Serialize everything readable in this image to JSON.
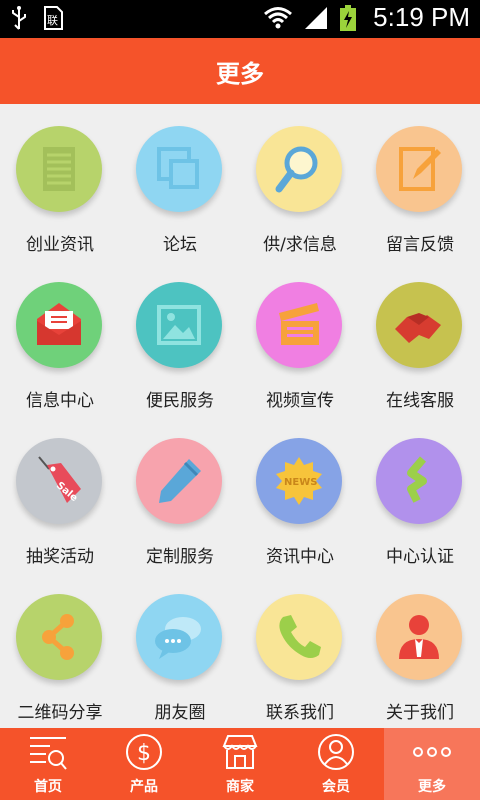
{
  "status_bar": {
    "time": "5:19 PM"
  },
  "header": {
    "title": "更多"
  },
  "grid": {
    "items": [
      {
        "label": "创业资讯",
        "icon": "document-icon",
        "color": "#b7d36b"
      },
      {
        "label": "论坛",
        "icon": "windows-icon",
        "color": "#8fd6f2"
      },
      {
        "label": "供/求信息",
        "icon": "magnifier-icon",
        "color": "#f9e596"
      },
      {
        "label": "留言反馈",
        "icon": "edit-icon",
        "color": "#f9c58f"
      },
      {
        "label": "信息中心",
        "icon": "envelope-icon",
        "color": "#6fd17a"
      },
      {
        "label": "便民服务",
        "icon": "picture-icon",
        "color": "#4dc3c1"
      },
      {
        "label": "视频宣传",
        "icon": "clapperboard-icon",
        "color": "#f07fe2"
      },
      {
        "label": "在线客服",
        "icon": "handshake-icon",
        "color": "#c6c24f"
      },
      {
        "label": "抽奖活动",
        "icon": "sale-tag-icon",
        "color": "#c3c7cd"
      },
      {
        "label": "定制服务",
        "icon": "pen-icon",
        "color": "#f7a3ad"
      },
      {
        "label": "资讯中心",
        "icon": "news-badge-icon",
        "color": "#86a3e6"
      },
      {
        "label": "中心认证",
        "icon": "certification-icon",
        "color": "#b191ec"
      },
      {
        "label": "二维码分享",
        "icon": "share-icon",
        "color": "#b7d36b"
      },
      {
        "label": "朋友圈",
        "icon": "chat-bubbles-icon",
        "color": "#8fd6f2"
      },
      {
        "label": "联系我们",
        "icon": "phone-icon",
        "color": "#f9e596"
      },
      {
        "label": "关于我们",
        "icon": "person-icon",
        "color": "#f9c58f"
      }
    ]
  },
  "tabbar": {
    "tabs": [
      {
        "label": "首页",
        "icon": "home-list-icon",
        "active": false
      },
      {
        "label": "产品",
        "icon": "dollar-icon",
        "active": false
      },
      {
        "label": "商家",
        "icon": "store-icon",
        "active": false
      },
      {
        "label": "会员",
        "icon": "user-icon",
        "active": false
      },
      {
        "label": "更多",
        "icon": "more-dots-icon",
        "active": true
      }
    ]
  }
}
